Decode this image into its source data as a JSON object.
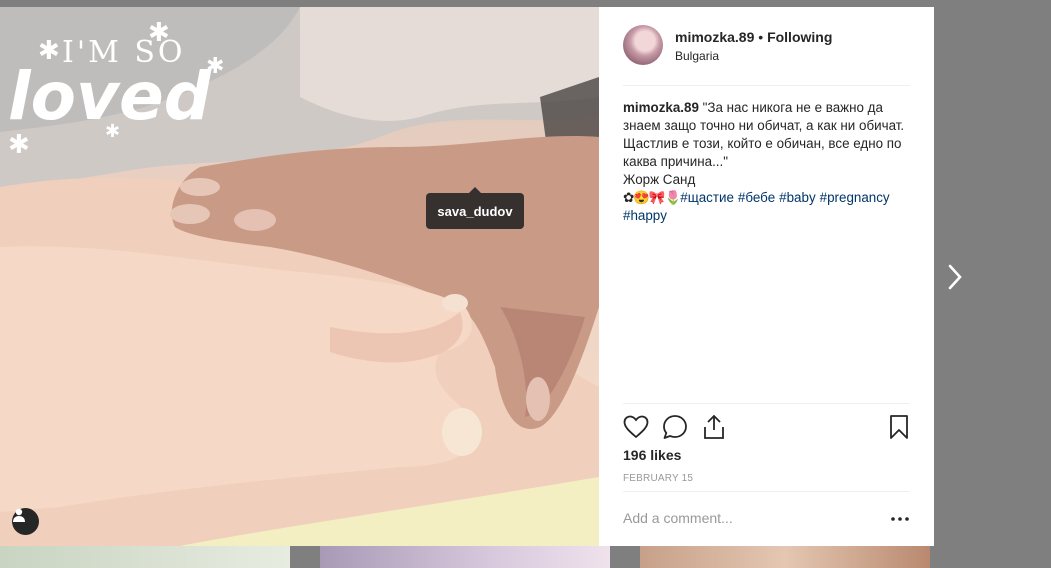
{
  "photo": {
    "overlay_text_top": "I'M SO",
    "overlay_text_main": "loved",
    "tag_label": "sava_dudov",
    "user_tag_icon": "person-icon"
  },
  "post": {
    "username": "mimozka.89",
    "separator": " • ",
    "follow_label": "Following",
    "location": "Bulgaria"
  },
  "caption": {
    "username": "mimozka.89",
    "text": "\"За нас никога не е важно да знаем защо точно ни обичат, а как ни обичат. Щастлив е този, който е обичан, все едно по каква причина...\"",
    "author": "Жорж Санд",
    "emoji": "✿😍🎀🌷",
    "hashtags": [
      "#щастие",
      "#бебе",
      "#baby",
      "#pregnancy",
      "#happy"
    ]
  },
  "actions": {
    "like_icon": "heart-icon",
    "comment_icon": "comment-icon",
    "share_icon": "share-icon",
    "save_icon": "bookmark-icon"
  },
  "likes": "196 likes",
  "date": "FEBRUARY 15",
  "comment": {
    "placeholder": "Add a comment...",
    "more_icon": "more-icon"
  },
  "nav": {
    "next_icon": "chevron-right-icon"
  }
}
